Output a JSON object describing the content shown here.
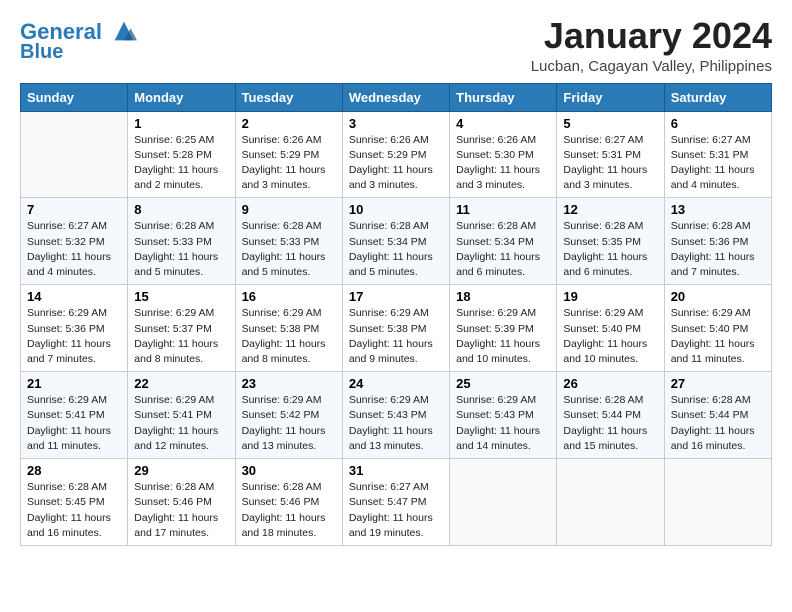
{
  "header": {
    "logo_line1": "General",
    "logo_line2": "Blue",
    "title": "January 2024",
    "subtitle": "Lucban, Cagayan Valley, Philippines"
  },
  "days_of_week": [
    "Sunday",
    "Monday",
    "Tuesday",
    "Wednesday",
    "Thursday",
    "Friday",
    "Saturday"
  ],
  "weeks": [
    [
      {
        "num": "",
        "info": ""
      },
      {
        "num": "1",
        "info": "Sunrise: 6:25 AM\nSunset: 5:28 PM\nDaylight: 11 hours\nand 2 minutes."
      },
      {
        "num": "2",
        "info": "Sunrise: 6:26 AM\nSunset: 5:29 PM\nDaylight: 11 hours\nand 3 minutes."
      },
      {
        "num": "3",
        "info": "Sunrise: 6:26 AM\nSunset: 5:29 PM\nDaylight: 11 hours\nand 3 minutes."
      },
      {
        "num": "4",
        "info": "Sunrise: 6:26 AM\nSunset: 5:30 PM\nDaylight: 11 hours\nand 3 minutes."
      },
      {
        "num": "5",
        "info": "Sunrise: 6:27 AM\nSunset: 5:31 PM\nDaylight: 11 hours\nand 3 minutes."
      },
      {
        "num": "6",
        "info": "Sunrise: 6:27 AM\nSunset: 5:31 PM\nDaylight: 11 hours\nand 4 minutes."
      }
    ],
    [
      {
        "num": "7",
        "info": "Sunrise: 6:27 AM\nSunset: 5:32 PM\nDaylight: 11 hours\nand 4 minutes."
      },
      {
        "num": "8",
        "info": "Sunrise: 6:28 AM\nSunset: 5:33 PM\nDaylight: 11 hours\nand 5 minutes."
      },
      {
        "num": "9",
        "info": "Sunrise: 6:28 AM\nSunset: 5:33 PM\nDaylight: 11 hours\nand 5 minutes."
      },
      {
        "num": "10",
        "info": "Sunrise: 6:28 AM\nSunset: 5:34 PM\nDaylight: 11 hours\nand 5 minutes."
      },
      {
        "num": "11",
        "info": "Sunrise: 6:28 AM\nSunset: 5:34 PM\nDaylight: 11 hours\nand 6 minutes."
      },
      {
        "num": "12",
        "info": "Sunrise: 6:28 AM\nSunset: 5:35 PM\nDaylight: 11 hours\nand 6 minutes."
      },
      {
        "num": "13",
        "info": "Sunrise: 6:28 AM\nSunset: 5:36 PM\nDaylight: 11 hours\nand 7 minutes."
      }
    ],
    [
      {
        "num": "14",
        "info": "Sunrise: 6:29 AM\nSunset: 5:36 PM\nDaylight: 11 hours\nand 7 minutes."
      },
      {
        "num": "15",
        "info": "Sunrise: 6:29 AM\nSunset: 5:37 PM\nDaylight: 11 hours\nand 8 minutes."
      },
      {
        "num": "16",
        "info": "Sunrise: 6:29 AM\nSunset: 5:38 PM\nDaylight: 11 hours\nand 8 minutes."
      },
      {
        "num": "17",
        "info": "Sunrise: 6:29 AM\nSunset: 5:38 PM\nDaylight: 11 hours\nand 9 minutes."
      },
      {
        "num": "18",
        "info": "Sunrise: 6:29 AM\nSunset: 5:39 PM\nDaylight: 11 hours\nand 10 minutes."
      },
      {
        "num": "19",
        "info": "Sunrise: 6:29 AM\nSunset: 5:40 PM\nDaylight: 11 hours\nand 10 minutes."
      },
      {
        "num": "20",
        "info": "Sunrise: 6:29 AM\nSunset: 5:40 PM\nDaylight: 11 hours\nand 11 minutes."
      }
    ],
    [
      {
        "num": "21",
        "info": "Sunrise: 6:29 AM\nSunset: 5:41 PM\nDaylight: 11 hours\nand 11 minutes."
      },
      {
        "num": "22",
        "info": "Sunrise: 6:29 AM\nSunset: 5:41 PM\nDaylight: 11 hours\nand 12 minutes."
      },
      {
        "num": "23",
        "info": "Sunrise: 6:29 AM\nSunset: 5:42 PM\nDaylight: 11 hours\nand 13 minutes."
      },
      {
        "num": "24",
        "info": "Sunrise: 6:29 AM\nSunset: 5:43 PM\nDaylight: 11 hours\nand 13 minutes."
      },
      {
        "num": "25",
        "info": "Sunrise: 6:29 AM\nSunset: 5:43 PM\nDaylight: 11 hours\nand 14 minutes."
      },
      {
        "num": "26",
        "info": "Sunrise: 6:28 AM\nSunset: 5:44 PM\nDaylight: 11 hours\nand 15 minutes."
      },
      {
        "num": "27",
        "info": "Sunrise: 6:28 AM\nSunset: 5:44 PM\nDaylight: 11 hours\nand 16 minutes."
      }
    ],
    [
      {
        "num": "28",
        "info": "Sunrise: 6:28 AM\nSunset: 5:45 PM\nDaylight: 11 hours\nand 16 minutes."
      },
      {
        "num": "29",
        "info": "Sunrise: 6:28 AM\nSunset: 5:46 PM\nDaylight: 11 hours\nand 17 minutes."
      },
      {
        "num": "30",
        "info": "Sunrise: 6:28 AM\nSunset: 5:46 PM\nDaylight: 11 hours\nand 18 minutes."
      },
      {
        "num": "31",
        "info": "Sunrise: 6:27 AM\nSunset: 5:47 PM\nDaylight: 11 hours\nand 19 minutes."
      },
      {
        "num": "",
        "info": ""
      },
      {
        "num": "",
        "info": ""
      },
      {
        "num": "",
        "info": ""
      }
    ]
  ]
}
